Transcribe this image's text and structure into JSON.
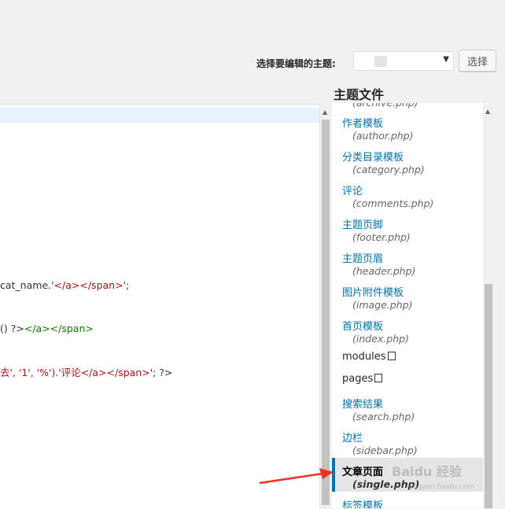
{
  "header": {
    "theme_select_label": "选择要编辑的主题:",
    "select_button": "选择"
  },
  "editor": {
    "lines": [
      {
        "segments": [
          {
            "text": "cat_name.'",
            "cls": "c-dark"
          },
          {
            "text": "</a></span>",
            "cls": "c-str"
          },
          {
            "text": "';",
            "cls": "c-dark"
          }
        ]
      },
      {
        "segments": [
          {
            "text": "() ?>",
            "cls": "c-dark"
          },
          {
            "text": "</a></span>",
            "cls": "c-tag"
          }
        ]
      },
      {
        "segments": [
          {
            "text": "去', '1', '%').'",
            "cls": "c-str"
          },
          {
            "text": "评论</a></span>",
            "cls": "c-str"
          },
          {
            "text": "'; ?>",
            "cls": "c-dark"
          }
        ]
      }
    ]
  },
  "files_panel": {
    "title": "主题文件",
    "items": [
      {
        "name": "",
        "file": "(archive.php)"
      },
      {
        "name": "作者模板",
        "file": "(author.php)"
      },
      {
        "name": "分类目录模板",
        "file": "(category.php)"
      },
      {
        "name": "评论",
        "file": "(comments.php)"
      },
      {
        "name": "主题页脚",
        "file": "(footer.php)"
      },
      {
        "name": "主题页眉",
        "file": "(header.php)"
      },
      {
        "name": "图片附件模板",
        "file": "(image.php)"
      },
      {
        "name": "首页模板",
        "file": "(index.php)"
      },
      {
        "name": "modules",
        "file": "",
        "dir": true
      },
      {
        "name": "pages",
        "file": "",
        "dir": true
      },
      {
        "name": "搜索结果",
        "file": "(search.php)"
      },
      {
        "name": "边栏",
        "file": "(sidebar.php)"
      },
      {
        "name": "文章页面",
        "file": "(single.php)",
        "current": true
      },
      {
        "name": "标签模板",
        "file": ""
      }
    ]
  },
  "watermark": {
    "main": "Baidu 经验",
    "sub": "jingyan.baidu.com"
  },
  "colors": {
    "link": "#0073aa",
    "arrow": "#e8332a"
  }
}
